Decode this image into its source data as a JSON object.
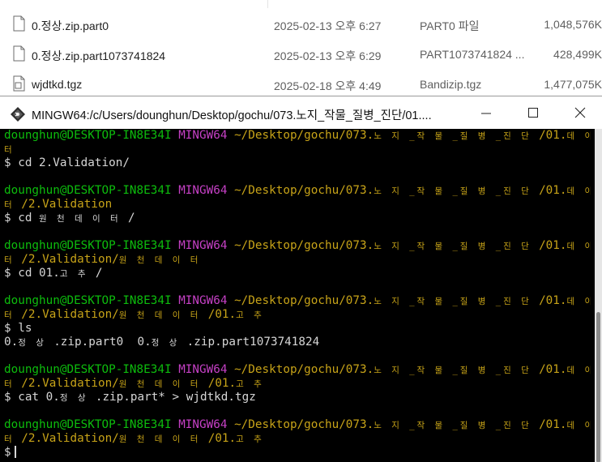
{
  "explorer": {
    "files": [
      {
        "name": "0.정상.zip.part0",
        "date": "2025-02-13 오후 6:27",
        "type": "PART0 파일",
        "size": "1,048,576K",
        "icon": "document-icon"
      },
      {
        "name": "0.정상.zip.part1073741824",
        "date": "2025-02-13 오후 6:29",
        "type": "PART1073741824 ...",
        "size": "428,499K",
        "icon": "document-icon"
      },
      {
        "name": "wjdtkd.tgz",
        "date": "2025-02-18 오후 4:49",
        "type": "Bandizip.tgz",
        "size": "1,477,075K",
        "icon": "archive-icon"
      }
    ]
  },
  "terminal": {
    "title": "MINGW64:/c/Users/dounghun/Desktop/gochu/073.노지_작물_질병_진단/01....",
    "icon": "git-bash-icon",
    "colors": {
      "user": "#0dbc0d",
      "system": "#c540c5",
      "path": "#c7a318",
      "text": "#d6d6d6"
    },
    "prompt": {
      "user": "dounghun@DESKTOP-IN8E34I",
      "system": "MINGW64",
      "path_line1": "~/Desktop/gochu/073.",
      "path_line1_kr": "노 지 _작 물 _질 병 _진 단 ",
      "path_line1_tail": "/01.",
      "path_line1_tail_kr": "데 이",
      "path_line2_kr": "터",
      "dollar": "$"
    },
    "blocks": [
      {
        "cwd_line2": "",
        "cwd_line2_kr": "",
        "command": "cd 2.Validation/",
        "command_kr": "",
        "command_tail": "",
        "output": ""
      },
      {
        "cwd_line2": " /2.Validation",
        "cwd_line2_kr": "",
        "command": "cd ",
        "command_kr": "원 천 데 이 터 ",
        "command_tail": "/",
        "output": ""
      },
      {
        "cwd_line2": " /2.Validation/",
        "cwd_line2_kr": "원 천 데 이 터",
        "command": "cd 01.",
        "command_kr": "고 추 ",
        "command_tail": "/",
        "output": ""
      },
      {
        "cwd_line2": " /2.Validation/",
        "cwd_line2_kr": "원 천 데 이 터 ",
        "cwd_line2_tail": "/01.",
        "cwd_line2_tail_kr": "고 추",
        "command": "ls",
        "output_parts": [
          "0.",
          "정 상 ",
          ".zip.part0  0.",
          "정 상 ",
          ".zip.part1073741824"
        ]
      },
      {
        "cwd_line2": " /2.Validation/",
        "cwd_line2_kr": "원 천 데 이 터 ",
        "cwd_line2_tail": "/01.",
        "cwd_line2_tail_kr": "고 추",
        "command": "cat 0.",
        "command_kr": "정 상 ",
        "command_tail": ".zip.part* > wjdtkd.tgz"
      },
      {
        "cwd_line2": " /2.Validation/",
        "cwd_line2_kr": "원 천 데 이 터 ",
        "cwd_line2_tail": "/01.",
        "cwd_line2_tail_kr": "고 추",
        "command": "",
        "cursor": true
      }
    ]
  }
}
